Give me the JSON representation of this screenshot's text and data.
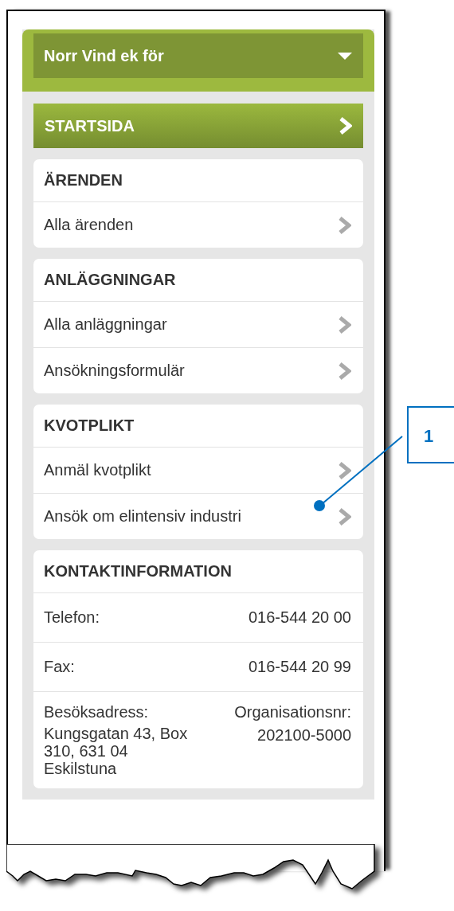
{
  "dropdown": {
    "label": "Norr Vind ek för"
  },
  "start_link": {
    "label": "STARTSIDA"
  },
  "sections": [
    {
      "title": "ÄRENDEN",
      "items": [
        {
          "label": "Alla ärenden"
        }
      ]
    },
    {
      "title": "ANLÄGGNINGAR",
      "items": [
        {
          "label": "Alla anläggningar"
        },
        {
          "label": "Ansökningsformulär"
        }
      ]
    },
    {
      "title": "KVOTPLIKT",
      "items": [
        {
          "label": "Anmäl kvotplikt"
        },
        {
          "label": "Ansök om elintensiv industri"
        }
      ]
    }
  ],
  "contact": {
    "title": "KONTAKTINFORMATION",
    "rows": [
      {
        "label": "Telefon:",
        "value": "016-544 20 00"
      },
      {
        "label": "Fax:",
        "value": "016-544 20 99"
      }
    ],
    "address": {
      "label": "Besöksadress:",
      "value": "Kungsgatan 43, Box 310, 631 04 Eskilstuna"
    },
    "org": {
      "label": "Organisationsnr:",
      "value": "202100-5000"
    }
  },
  "callout": {
    "number": "1"
  }
}
